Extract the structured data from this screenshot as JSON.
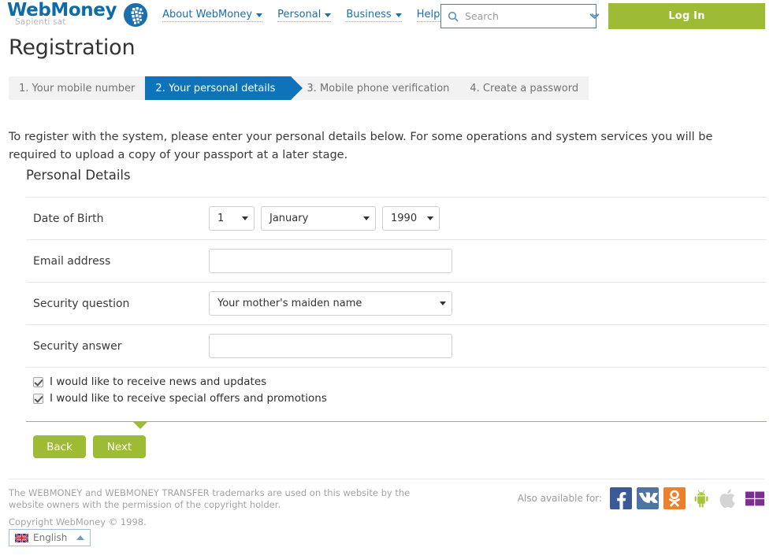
{
  "header": {
    "logo": {
      "main": "WebMoney",
      "tagline": "Sapienti sat",
      "icon": "webmoney-globe-icon"
    },
    "nav": [
      {
        "label": "About WebMoney"
      },
      {
        "label": "Personal"
      },
      {
        "label": "Business"
      },
      {
        "label": "Help"
      }
    ],
    "search": {
      "placeholder": "Search",
      "value": "",
      "icon": "search-icon"
    },
    "login_label": "Log In"
  },
  "page": {
    "title": "Registration",
    "intro": "To register with the system, please enter your personal details below. For some operations and system services you will be required to upload a copy of your passport at a later stage."
  },
  "steps": [
    {
      "label": "1. Your mobile number",
      "active": false
    },
    {
      "label": "2. Your personal details",
      "active": true
    },
    {
      "label": "3. Mobile phone verification",
      "active": false
    },
    {
      "label": "4. Create a password",
      "active": false
    }
  ],
  "form": {
    "section_title": "Personal Details",
    "dob": {
      "label": "Date of Birth",
      "day": "1",
      "month": "January",
      "year": "1990"
    },
    "email": {
      "label": "Email address",
      "value": "",
      "placeholder": ""
    },
    "security_question": {
      "label": "Security question",
      "value": "Your mother's maiden name"
    },
    "security_answer": {
      "label": "Security answer",
      "value": "",
      "placeholder": ""
    },
    "checkboxes": [
      {
        "label": "I would like to receive news and updates",
        "checked": true
      },
      {
        "label": "I would like to receive special offers and promotions",
        "checked": true
      }
    ],
    "buttons": {
      "back": "Back",
      "next": "Next"
    }
  },
  "footer": {
    "trademark": "The WEBMONEY and WEBMONEY TRANSFER trademarks are used on this website by the website owners with the permission of the copyright holder.",
    "copyright": "Copyright WebMoney © 1998.",
    "available_label": "Also available for:",
    "apps": [
      {
        "name": "facebook-icon"
      },
      {
        "name": "vk-icon"
      },
      {
        "name": "odnoklassniki-icon"
      },
      {
        "name": "android-icon"
      },
      {
        "name": "apple-icon"
      },
      {
        "name": "windows-icon"
      }
    ],
    "language": {
      "label": "English",
      "flag": "uk-flag-icon"
    }
  },
  "colors": {
    "brand_blue": "#0d6ba8",
    "active_tab_blue": "#0f73b9",
    "green": "#9dbb35",
    "tab_bg": "#f2f2f2"
  }
}
